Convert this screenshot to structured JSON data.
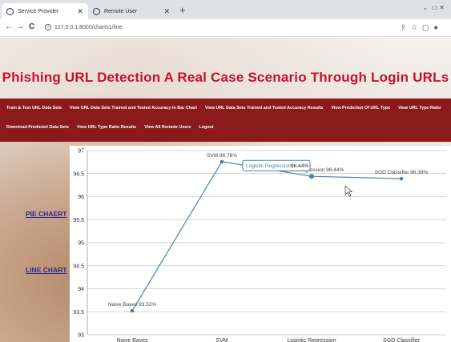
{
  "browser": {
    "tabs": [
      {
        "title": "Service Provider",
        "active": true
      },
      {
        "title": "Remote User",
        "active": false
      }
    ],
    "new_tab_symbol": "+",
    "url": "127.0.0.1:8000/charts1/line",
    "nav": {
      "back": "←",
      "forward": "→",
      "reload": "C"
    }
  },
  "page": {
    "title": "Phishing URL Detection A Real Case Scenario Through Login URLs",
    "menu_row1": [
      "Train & Test URL Data Sets",
      "View URL Data Sets Trained and Tested Accuracy in Bar Chart",
      "View URL Data Sets Trained and Tested Accuracy Results",
      "View Prediction Of URL Type",
      "View URL Type Ratio"
    ],
    "menu_row2": [
      "Download Predicted Data Sets",
      "View URL Type Ratio Results",
      "View All Remote Users",
      "Logout"
    ],
    "side_links": {
      "pie": "PIE CHAERT",
      "line": "LINE CHART"
    },
    "colors": {
      "title": "#c8102e",
      "menubar": "#8b1a1a",
      "line": "#4a7fb0",
      "side_link": "#2b2a8f"
    }
  },
  "chart_data": {
    "type": "line",
    "categories": [
      "Naive Bayes",
      "SVM",
      "Logistic Regression",
      "SGD Classifier"
    ],
    "values": [
      93.52,
      96.76,
      96.44,
      96.39
    ],
    "point_labels": [
      "Naive Bayes 93.52%",
      "SVM 96.76%",
      "Logistic Regression 96.44%",
      "SGD Classifier 96.39%"
    ],
    "yticks": [
      "93",
      "93.5",
      "94",
      "94.5",
      "95",
      "95.5",
      "96",
      "96.5",
      "97"
    ],
    "ylim": [
      93,
      97
    ],
    "grid": true,
    "tooltip": {
      "label": "Logistic Regression:",
      "value": "96.44%",
      "category_index": 2
    }
  }
}
